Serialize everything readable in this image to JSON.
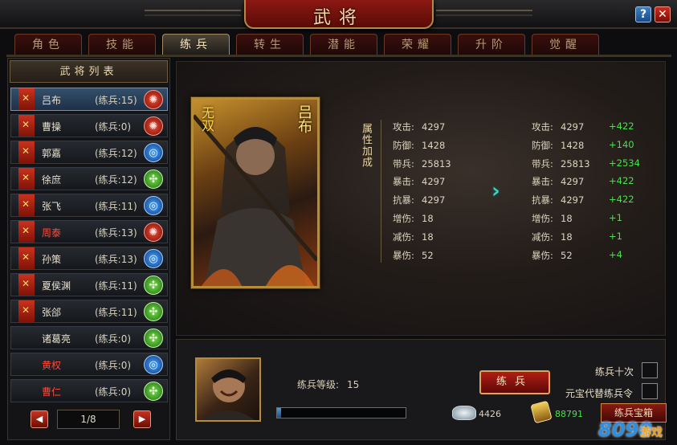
{
  "window": {
    "title": "武将",
    "help_label": "?",
    "close_label": "✕"
  },
  "tabs": [
    {
      "label": "角色"
    },
    {
      "label": "技能"
    },
    {
      "label": "练兵"
    },
    {
      "label": "转生"
    },
    {
      "label": "潜能"
    },
    {
      "label": "荣耀"
    },
    {
      "label": "升阶"
    },
    {
      "label": "觉醒"
    }
  ],
  "active_tab": "练兵",
  "general_list": {
    "header": "武将列表",
    "items": [
      {
        "name": "吕布",
        "train": "(练兵:15)",
        "element": "fire",
        "name_color": "normal",
        "selected": true,
        "flag": true
      },
      {
        "name": "曹操",
        "train": "(练兵:0)",
        "element": "fire",
        "name_color": "normal",
        "flag": true
      },
      {
        "name": "郭嘉",
        "train": "(练兵:12)",
        "element": "water",
        "name_color": "normal",
        "flag": true
      },
      {
        "name": "徐庶",
        "train": "(练兵:12)",
        "element": "wood",
        "name_color": "normal",
        "flag": true
      },
      {
        "name": "张飞",
        "train": "(练兵:11)",
        "element": "water",
        "name_color": "normal",
        "flag": true
      },
      {
        "name": "周泰",
        "train": "(练兵:13)",
        "element": "fire",
        "name_color": "red",
        "flag": true
      },
      {
        "name": "孙策",
        "train": "(练兵:13)",
        "element": "water",
        "name_color": "normal",
        "flag": true
      },
      {
        "name": "夏侯渊",
        "train": "(练兵:11)",
        "element": "wood",
        "name_color": "normal",
        "flag": true
      },
      {
        "name": "张郃",
        "train": "(练兵:11)",
        "element": "wood",
        "name_color": "normal",
        "flag": true
      },
      {
        "name": "诸葛亮",
        "train": "(练兵:0)",
        "element": "wood",
        "name_color": "normal",
        "flag": false
      },
      {
        "name": "黄权",
        "train": "(练兵:0)",
        "element": "water",
        "name_color": "red",
        "flag": false
      },
      {
        "name": "曹仁",
        "train": "(练兵:0)",
        "element": "wood",
        "name_color": "red",
        "flag": false
      }
    ],
    "pager": {
      "text": "1/8",
      "prev_icon": "◀",
      "next_icon": "▶"
    }
  },
  "card": {
    "title": "无双",
    "name": "吕布"
  },
  "attributes": {
    "heading": "属性加成",
    "before": [
      {
        "label": "攻击:",
        "value": "4297"
      },
      {
        "label": "防御:",
        "value": "1428"
      },
      {
        "label": "带兵:",
        "value": "25813"
      },
      {
        "label": "暴击:",
        "value": "4297"
      },
      {
        "label": "抗暴:",
        "value": "4297"
      },
      {
        "label": "增伤:",
        "value": "18"
      },
      {
        "label": "减伤:",
        "value": "18"
      },
      {
        "label": "暴伤:",
        "value": "52"
      }
    ],
    "after": [
      {
        "label": "攻击:",
        "value": "4297",
        "inc": "+422"
      },
      {
        "label": "防御:",
        "value": "1428",
        "inc": "+140"
      },
      {
        "label": "带兵:",
        "value": "25813",
        "inc": "+2534"
      },
      {
        "label": "暴击:",
        "value": "4297",
        "inc": "+422"
      },
      {
        "label": "抗暴:",
        "value": "4297",
        "inc": "+422"
      },
      {
        "label": "增伤:",
        "value": "18",
        "inc": "+1"
      },
      {
        "label": "减伤:",
        "value": "18",
        "inc": "+1"
      },
      {
        "label": "暴伤:",
        "value": "52",
        "inc": "+4"
      }
    ],
    "arrow_icon": "›"
  },
  "training": {
    "level_label": "练兵等级:",
    "level_value": "15",
    "progress_fraction": 0.03,
    "train_button": "练兵",
    "option_ten": "练兵十次",
    "option_yuanbao": "元宝代替练兵令",
    "silver_value": "4426",
    "token_value": "88791",
    "extra_button": "练兵宝箱"
  },
  "watermark": {
    "number": "8090",
    "text": "游戏"
  },
  "colors": {
    "fire": "#c8321e",
    "water": "#1f6fd6",
    "wood": "#2f9a1e",
    "accent_gold": "#b58c38",
    "increase_green": "#4be04b"
  }
}
